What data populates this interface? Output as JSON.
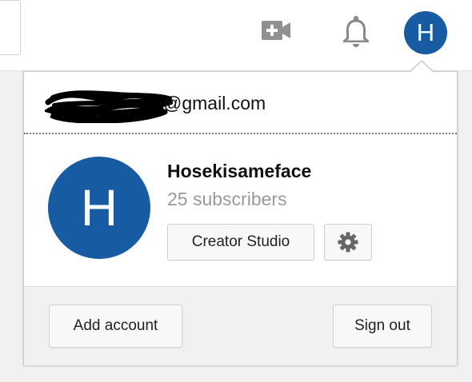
{
  "topbar": {
    "upload_icon": "video-camera-plus-icon",
    "notifications_icon": "bell-icon",
    "avatar_letter": "H"
  },
  "account": {
    "email": "@gmail.com",
    "channel_name": "Hosekisameface",
    "subscribers": "25 subscribers",
    "avatar_letter": "H",
    "avatar_color": "#175ba3"
  },
  "buttons": {
    "creator_studio": "Creator Studio",
    "settings_icon": "gear-icon",
    "add_account": "Add account",
    "sign_out": "Sign out"
  }
}
